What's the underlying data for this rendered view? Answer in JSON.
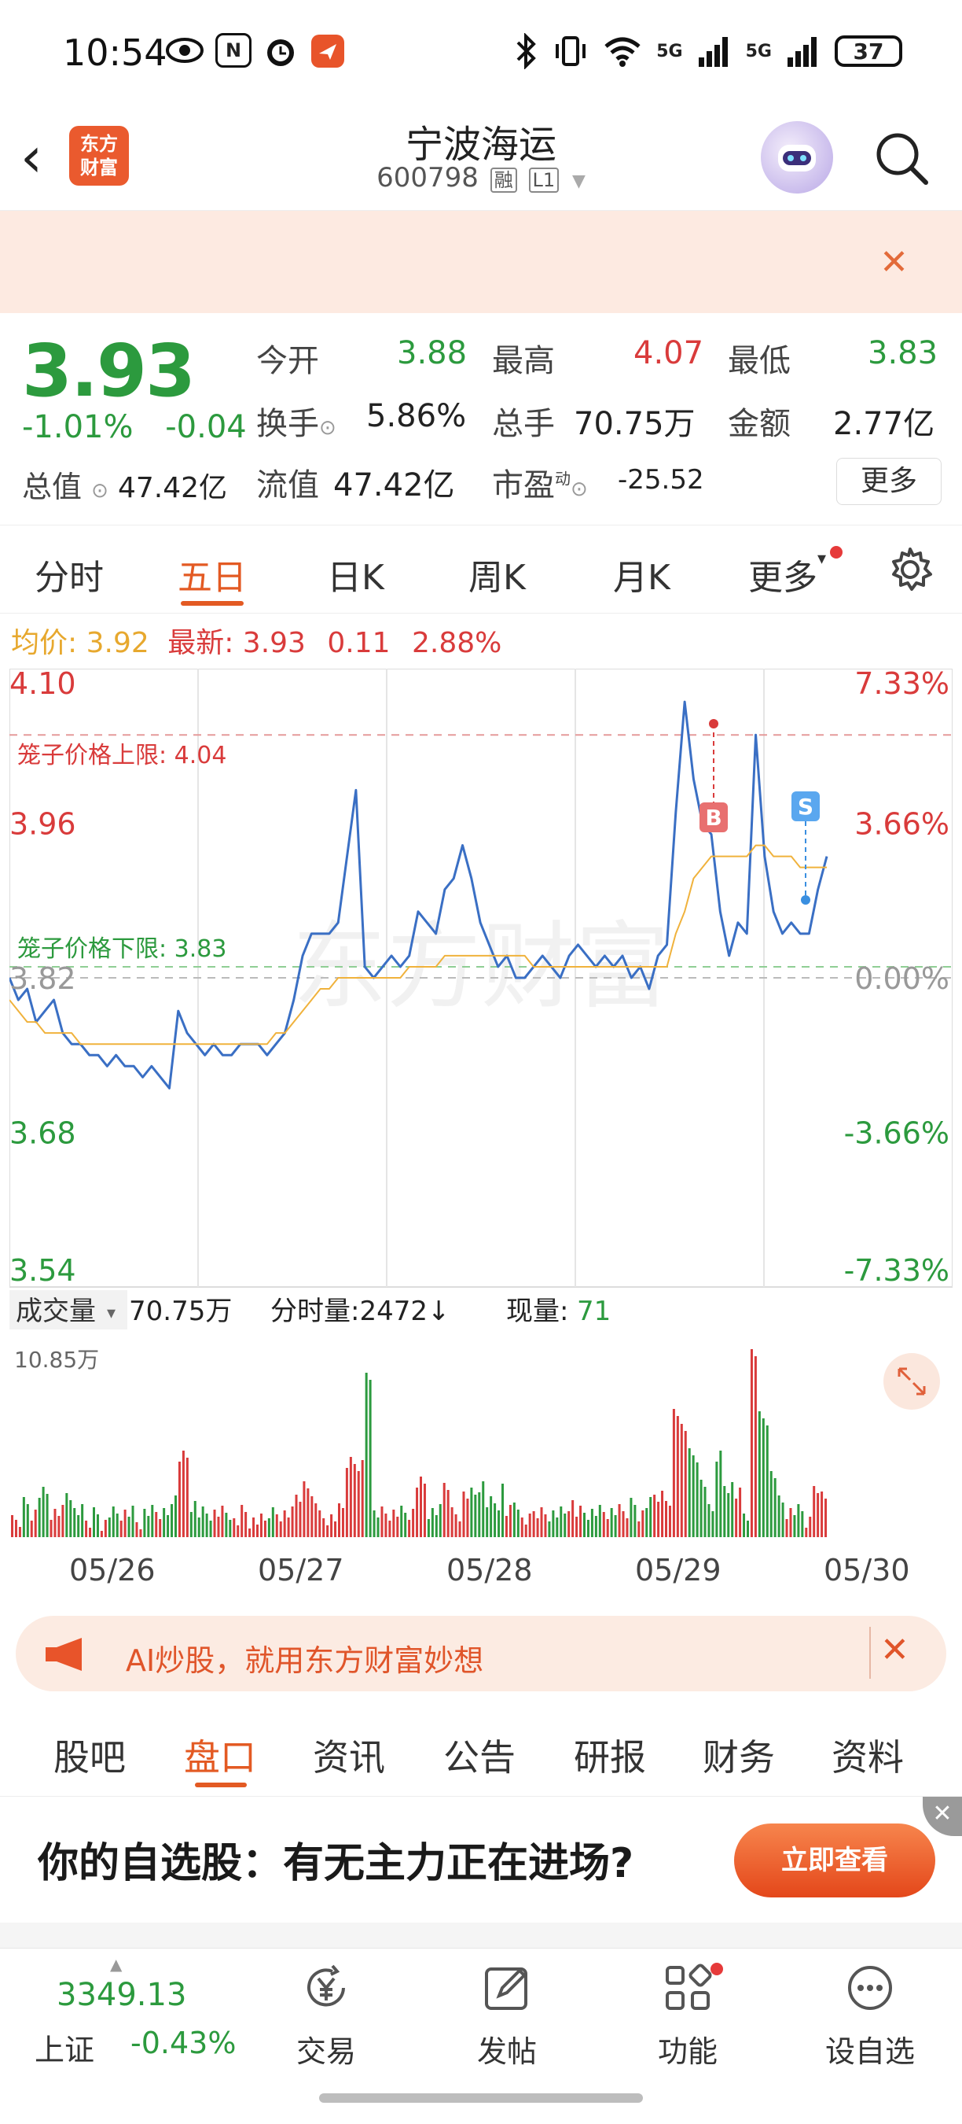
{
  "status_bar": {
    "time": "10:54",
    "nfc": "N",
    "net1": "5G",
    "net2": "5G",
    "battery": "37"
  },
  "header": {
    "back_glyph": "‹",
    "logo_line1": "东方",
    "logo_line2": "财富",
    "stock_name": "宁波海运",
    "stock_code": "600798",
    "badge_rong": "融",
    "badge_level": "L1",
    "dropdown_glyph": "▼"
  },
  "notice": {
    "close_glyph": "✕"
  },
  "quote": {
    "price": "3.93",
    "change_pct": "-1.01%",
    "change_amt": "-0.04",
    "open_label": "今开",
    "open_value": "3.88",
    "high_label": "最高",
    "high_value": "4.07",
    "low_label": "最低",
    "low_value": "3.83",
    "turnover_label": "换手",
    "turnover_value": "5.86%",
    "volume_label": "总手",
    "volume_value": "70.75万",
    "amount_label": "金额",
    "amount_value": "2.77亿",
    "mktcap_label": "总值",
    "mktcap_value": "47.42亿",
    "float_label": "流值",
    "float_value": "47.42亿",
    "pe_label": "市盈",
    "pe_sup": "动",
    "pe_value": "-25.52",
    "more_label": "更多"
  },
  "chart_tabs": {
    "items": [
      "分时",
      "五日",
      "日K",
      "周K",
      "月K",
      "更多"
    ],
    "active": "五日"
  },
  "avg_row": {
    "avg_label": "均价:",
    "avg_value": "3.92",
    "latest_label": "最新:",
    "latest_value": "3.93",
    "latest_chg": "0.11",
    "latest_pct": "2.88%"
  },
  "chart_labels": {
    "upper_limit": "笼子价格上限: 4.04",
    "lower_limit": "笼子价格下限: 3.83",
    "buy_marker": "B",
    "sell_marker": "S",
    "watermark": "东方财富"
  },
  "volume_panel": {
    "label": "成交量",
    "total": "70.75万",
    "tick_label": "分时量:2472↓",
    "current_label": "现量:",
    "current_value": "71",
    "max_label": "10.85万"
  },
  "chart_data": {
    "type": "line",
    "title": "",
    "x": [
      "05/26",
      "05/27",
      "05/28",
      "05/29",
      "05/30"
    ],
    "y_ticks": [
      "4.10",
      "3.96",
      "3.82",
      "3.68",
      "3.54"
    ],
    "y_pct_ticks": [
      "7.33%",
      "3.66%",
      "0.00%",
      "-3.66%",
      "-7.33%"
    ],
    "ylim": [
      3.54,
      4.1
    ],
    "prev_close": 3.82,
    "series": [
      {
        "values": [
          3.82,
          3.8,
          3.81,
          3.78,
          3.79,
          3.8,
          3.77,
          3.76,
          3.76,
          3.75,
          3.75,
          3.74,
          3.75,
          3.74,
          3.74,
          3.73,
          3.74,
          3.73,
          3.72,
          3.79,
          3.77,
          3.76,
          3.75,
          3.76,
          3.75,
          3.75,
          3.76,
          3.76,
          3.76,
          3.75,
          3.76,
          3.77,
          3.8,
          3.84,
          3.86,
          3.86,
          3.86,
          3.87,
          3.93,
          3.99,
          3.83,
          3.82,
          3.83,
          3.84,
          3.83,
          3.84,
          3.88,
          3.87,
          3.86,
          3.9,
          3.91,
          3.94,
          3.91,
          3.87,
          3.85,
          3.83,
          3.84,
          3.82,
          3.82,
          3.83,
          3.84,
          3.83,
          3.82,
          3.84,
          3.85,
          3.84,
          3.83,
          3.84,
          3.83,
          3.84,
          3.82,
          3.83,
          3.81,
          3.84,
          3.85,
          3.97,
          4.07,
          4.0,
          3.96,
          3.95,
          3.88,
          3.84,
          3.87,
          3.86,
          4.04,
          3.93,
          3.88,
          3.86,
          3.87,
          3.86,
          3.86,
          3.9,
          3.93
        ]
      },
      {
        "values": [
          3.8,
          3.79,
          3.78,
          3.78,
          3.77,
          3.77,
          3.77,
          3.77,
          3.76,
          3.76,
          3.76,
          3.76,
          3.76,
          3.76,
          3.76,
          3.76,
          3.76,
          3.76,
          3.76,
          3.76,
          3.76,
          3.76,
          3.76,
          3.76,
          3.76,
          3.76,
          3.76,
          3.76,
          3.76,
          3.76,
          3.77,
          3.77,
          3.78,
          3.79,
          3.8,
          3.81,
          3.81,
          3.82,
          3.82,
          3.82,
          3.82,
          3.82,
          3.82,
          3.82,
          3.82,
          3.83,
          3.83,
          3.83,
          3.83,
          3.84,
          3.84,
          3.84,
          3.84,
          3.84,
          3.84,
          3.84,
          3.84,
          3.84,
          3.84,
          3.83,
          3.83,
          3.83,
          3.83,
          3.83,
          3.83,
          3.83,
          3.83,
          3.83,
          3.83,
          3.83,
          3.83,
          3.83,
          3.83,
          3.83,
          3.83,
          3.86,
          3.88,
          3.91,
          3.92,
          3.93,
          3.93,
          3.93,
          3.93,
          3.93,
          3.94,
          3.94,
          3.93,
          3.93,
          3.93,
          3.92,
          3.92,
          3.92,
          3.92
        ]
      }
    ],
    "volume_max": "10.85万",
    "grid": true
  },
  "ai_banner": {
    "text": "AI炒股，就用东方财富妙想",
    "close_glyph": "✕"
  },
  "bottom_tabs": {
    "items": [
      "股吧",
      "盘口",
      "资讯",
      "公告",
      "研报",
      "财务",
      "资料"
    ],
    "active": "盘口"
  },
  "ad": {
    "text": "你的自选股：有无主力正在进场?",
    "button": "立即查看",
    "close_glyph": "✕"
  },
  "bottom_bar": {
    "index_value": "3349.13",
    "index_name": "上证",
    "index_change": "-0.43%",
    "items": [
      "交易",
      "发帖",
      "功能",
      "设自选"
    ]
  },
  "colors": {
    "up": "#d93b3b",
    "down": "#2c9a3e",
    "accent": "#e35a23",
    "price_line": "#3a6fc4",
    "avg_line": "#f0b23c"
  }
}
